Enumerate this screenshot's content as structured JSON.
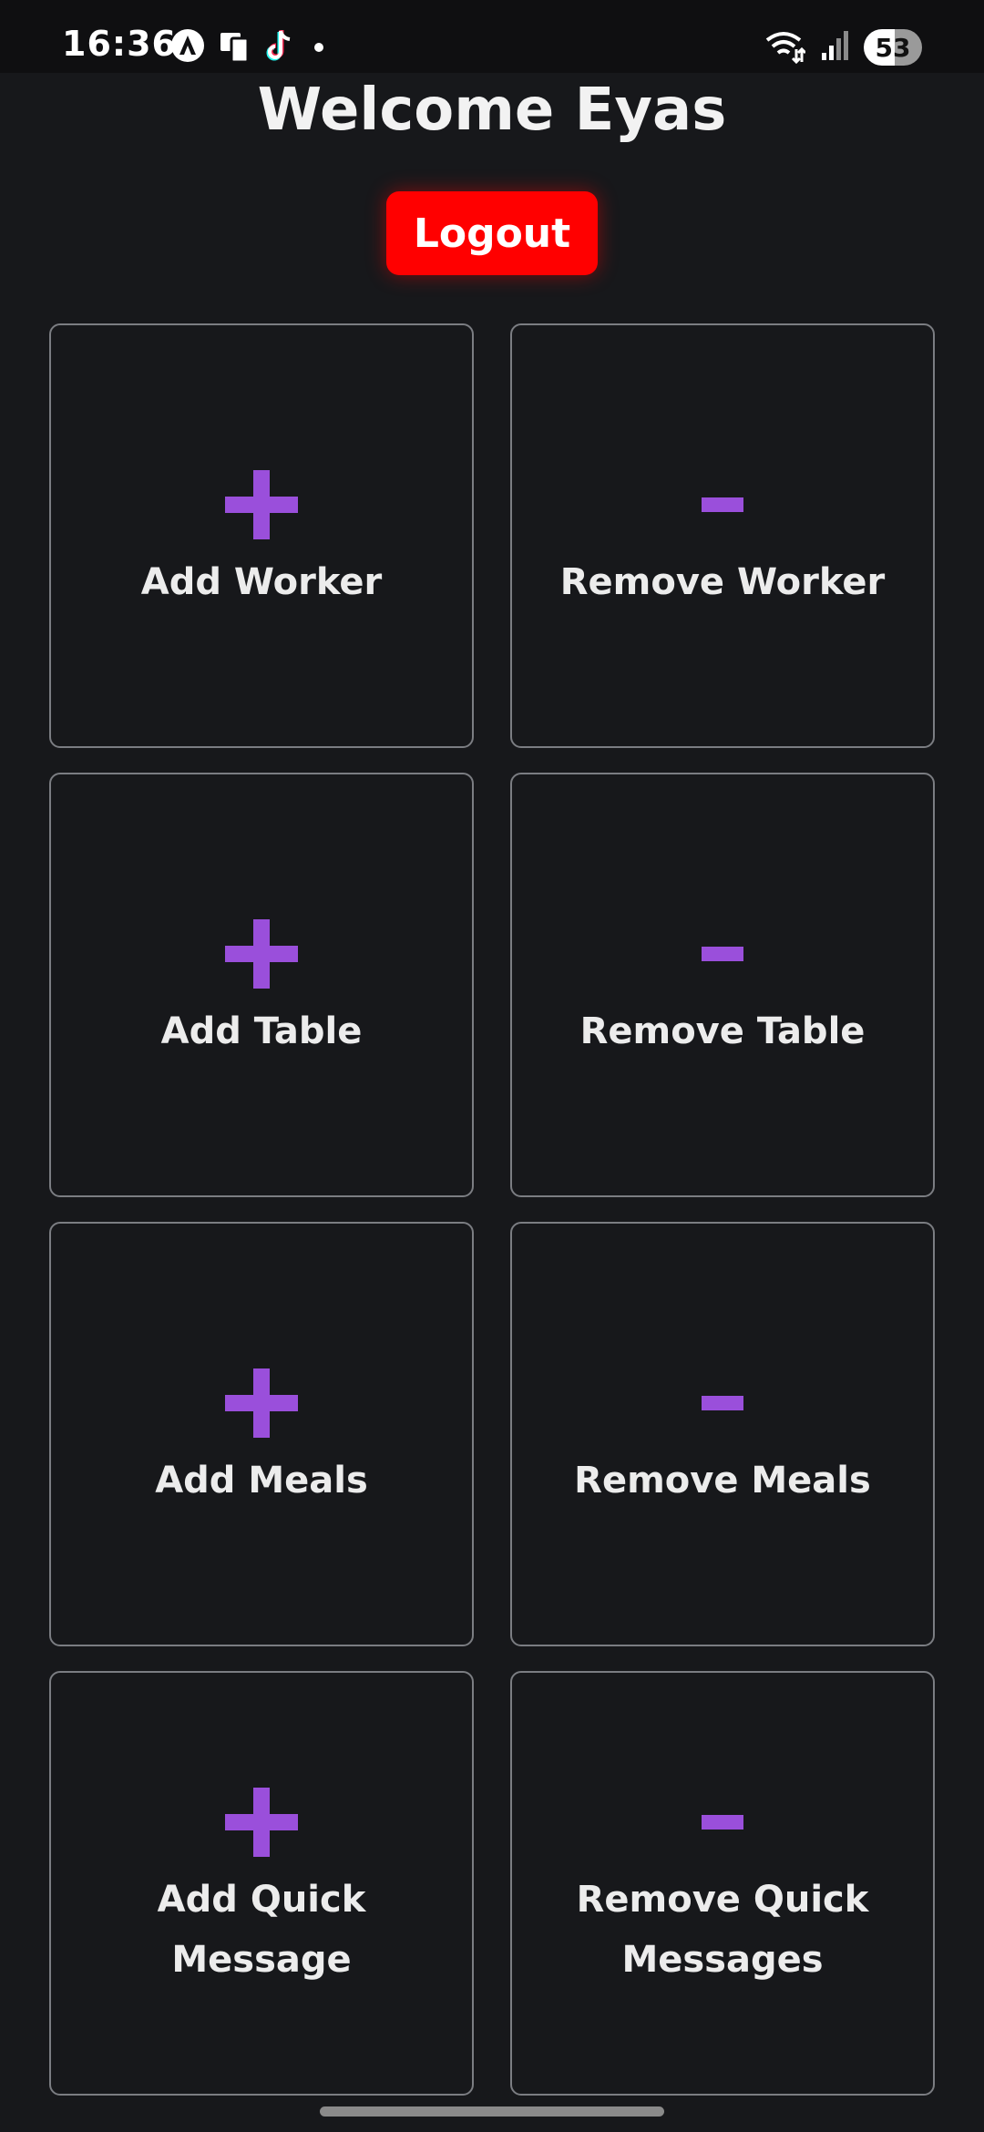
{
  "status_bar": {
    "time": "16:36",
    "battery": "53"
  },
  "header": {
    "welcome_text": "Welcome Eyas",
    "logout_label": "Logout"
  },
  "accent_color": "#9a4fdb",
  "logout_color": "#ff0000",
  "cards": [
    {
      "label": "Add Worker",
      "icon": "plus-icon"
    },
    {
      "label": "Remove Worker",
      "icon": "minus-icon"
    },
    {
      "label": "Add Table",
      "icon": "plus-icon"
    },
    {
      "label": "Remove Table",
      "icon": "minus-icon"
    },
    {
      "label": "Add Meals",
      "icon": "plus-icon"
    },
    {
      "label": "Remove Meals",
      "icon": "minus-icon"
    },
    {
      "label": "Add Quick Message",
      "icon": "plus-icon"
    },
    {
      "label": "Remove Quick Messages",
      "icon": "minus-icon"
    }
  ]
}
